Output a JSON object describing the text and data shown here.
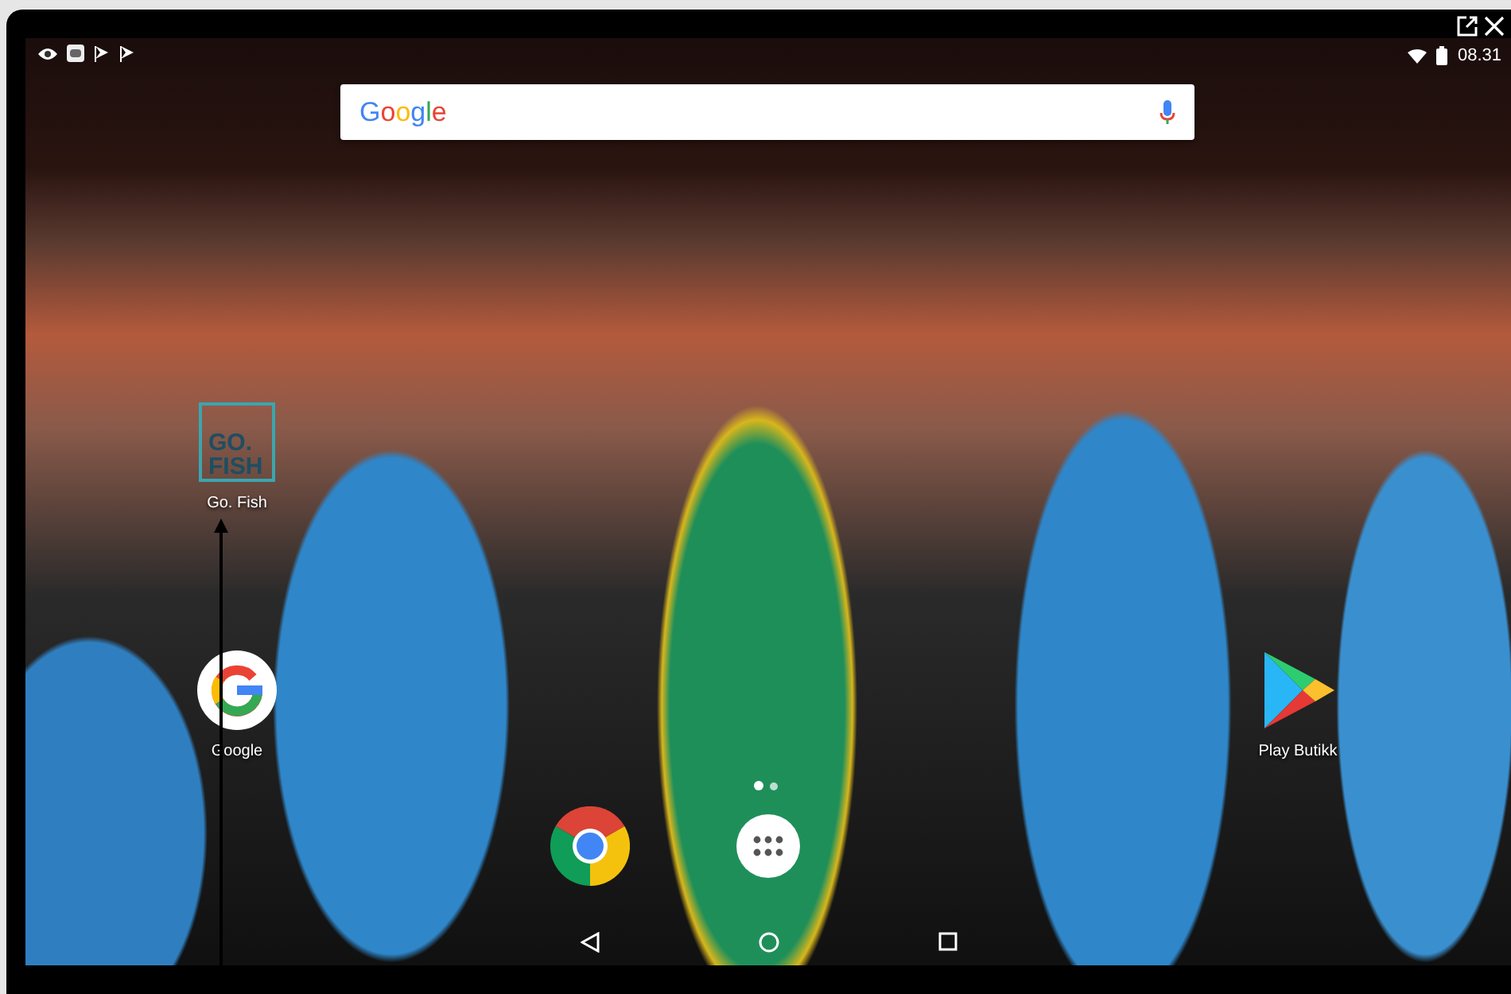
{
  "status_bar": {
    "time": "08.31"
  },
  "search_bar": {
    "logo": "Google"
  },
  "home_icons": [
    {
      "kind": "gofish",
      "label": "Go. Fish",
      "icon_text": [
        "GO.",
        "FISH"
      ]
    },
    {
      "kind": "google",
      "label": "Google"
    },
    {
      "kind": "play",
      "label": "Play Butikk"
    }
  ],
  "page_indicator": [
    {
      "selected": true
    },
    {
      "selected": false
    }
  ]
}
